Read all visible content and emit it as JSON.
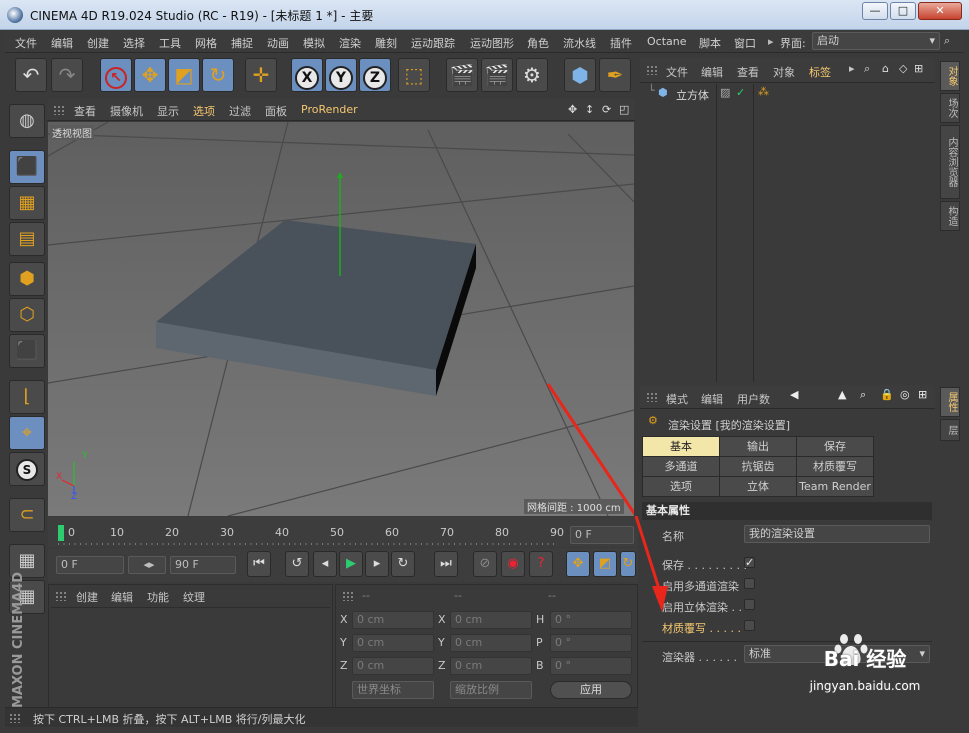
{
  "window": {
    "title": "CINEMA 4D R19.024 Studio (RC - R19) - [未标题 1 *] - 主要",
    "minimize": "—",
    "maximize": "□",
    "close": "✕"
  },
  "menubar": {
    "items": [
      "文件",
      "编辑",
      "创建",
      "选择",
      "工具",
      "网格",
      "捕捉",
      "动画",
      "模拟",
      "渲染",
      "雕刻",
      "运动跟踪",
      "运动图形",
      "角色",
      "流水线",
      "插件",
      "Octane",
      "脚本",
      "窗口"
    ],
    "layout_label": "界面:",
    "layout_value": "启动"
  },
  "viewport": {
    "menu": [
      "查看",
      "摄像机",
      "显示",
      "选项",
      "过滤",
      "面板",
      "ProRender"
    ],
    "name": "透视视图",
    "grid_spacing": "网格间距 : 1000 cm",
    "axis_x": "X",
    "axis_y": "Y",
    "axis_z": "Z"
  },
  "timeline": {
    "ticks": [
      "0",
      "10",
      "20",
      "30",
      "40",
      "50",
      "60",
      "70",
      "80",
      "90"
    ],
    "current_frame": "0 F",
    "progress": 0.0
  },
  "playback": {
    "start_field": "0 F",
    "end_field": "90 F"
  },
  "material_panel": {
    "menu": [
      "创建",
      "编辑",
      "功能",
      "纹理"
    ]
  },
  "coordinates": {
    "headers": [
      "--",
      "--",
      "--"
    ],
    "rows": [
      {
        "a": "X",
        "av": "0 cm",
        "b": "X",
        "bv": "0 cm",
        "c": "H",
        "cv": "0 °"
      },
      {
        "a": "Y",
        "av": "0 cm",
        "b": "Y",
        "bv": "0 cm",
        "c": "P",
        "cv": "0 °"
      },
      {
        "a": "Z",
        "av": "0 cm",
        "b": "Z",
        "bv": "0 cm",
        "c": "B",
        "cv": "0 °"
      }
    ],
    "coord_system": "世界坐标",
    "scale_mode": "缩放比例",
    "apply": "应用"
  },
  "status_bar": "按下 CTRL+LMB 折叠，按下 ALT+LMB 将行/列最大化",
  "objects_panel": {
    "menu": [
      "文件",
      "编辑",
      "查看",
      "对象",
      "标签"
    ],
    "objects": [
      {
        "name": "立方体"
      }
    ]
  },
  "attributes_panel": {
    "menu": [
      "模式",
      "编辑",
      "用户数"
    ],
    "title": "渲染设置 [我的渲染设置]",
    "tabs": [
      {
        "label": "基本",
        "active": true
      },
      {
        "label": "输出",
        "active": false
      },
      {
        "label": "保存",
        "active": false
      },
      {
        "label": "多通道",
        "active": false
      },
      {
        "label": "抗锯齿",
        "active": false
      },
      {
        "label": "材质覆写",
        "active": false
      },
      {
        "label": "选项",
        "active": false
      },
      {
        "label": "立体",
        "active": false
      },
      {
        "label": "Team Render",
        "active": false
      }
    ],
    "section": "基本属性",
    "name_label": "名称",
    "name_value": "我的渲染设置",
    "props": [
      {
        "label": "保存 . . . . . . . . .",
        "checked": true,
        "highlight": false
      },
      {
        "label": "启用多通道渲染",
        "checked": false,
        "highlight": false
      },
      {
        "label": "启用立体渲染 . .",
        "checked": false,
        "highlight": false
      },
      {
        "label": "材质覆写 . . . . .",
        "checked": false,
        "highlight": true
      }
    ],
    "renderer_label": "渲染器 . . . . . .",
    "renderer_value": "标准"
  },
  "side_tabs": {
    "top": [
      "对象",
      "场次",
      "内容浏览器",
      "构造"
    ],
    "bottom": [
      "属性",
      "层"
    ]
  },
  "watermark": {
    "brand": "Bai 经验",
    "url": "jingyan.baidu.com"
  },
  "colors": {
    "accent": "#f5c870",
    "selected_tab": "#f2e7a8",
    "arrow": "#e8261c",
    "toolbar_icon": "#e0a020"
  }
}
